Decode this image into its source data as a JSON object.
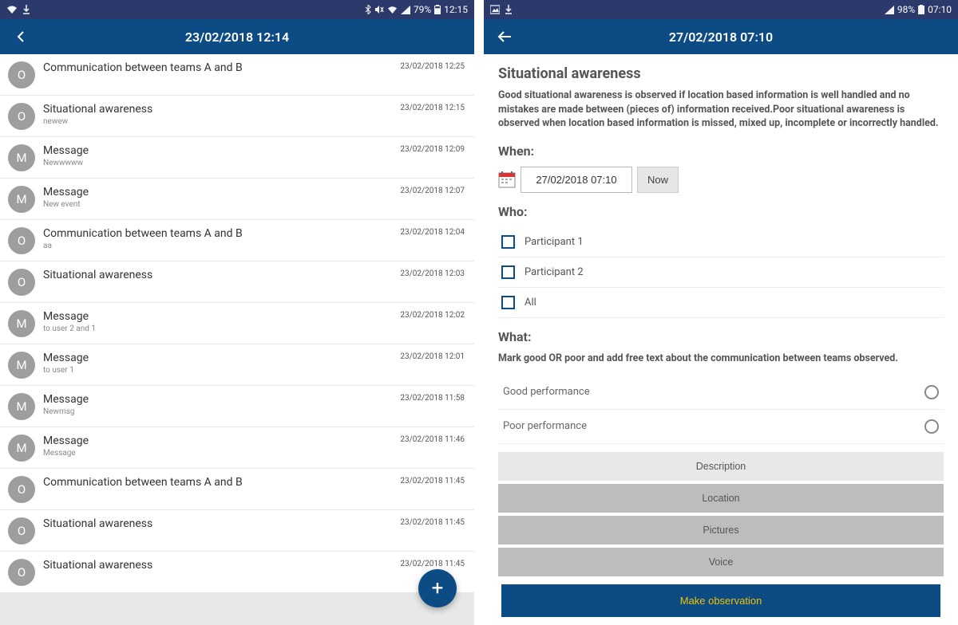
{
  "left": {
    "status": {
      "battery": "79%",
      "time": "12:15"
    },
    "appbar_title": "23/02/2018 12:14",
    "rows": [
      {
        "avatar": "O",
        "title": "Communication between teams A and B",
        "sub": "",
        "time": "23/02/2018 12:25"
      },
      {
        "avatar": "O",
        "title": "Situational awareness",
        "sub": "newew",
        "time": "23/02/2018 12:15"
      },
      {
        "avatar": "M",
        "title": "Message",
        "sub": "Newwwww",
        "time": "23/02/2018 12:09"
      },
      {
        "avatar": "M",
        "title": "Message",
        "sub": "New event",
        "time": "23/02/2018 12:07"
      },
      {
        "avatar": "O",
        "title": "Communication between teams A and B",
        "sub": "aa",
        "time": "23/02/2018 12:04"
      },
      {
        "avatar": "O",
        "title": "Situational awareness",
        "sub": "",
        "time": "23/02/2018 12:03"
      },
      {
        "avatar": "M",
        "title": "Message",
        "sub": "to user 2 and 1",
        "time": "23/02/2018 12:02"
      },
      {
        "avatar": "M",
        "title": "Message",
        "sub": "to user 1",
        "time": "23/02/2018 12:01"
      },
      {
        "avatar": "M",
        "title": "Message",
        "sub": "Newmsg",
        "time": "23/02/2018 11:58"
      },
      {
        "avatar": "M",
        "title": "Message",
        "sub": "Message",
        "time": "23/02/2018 11:46"
      },
      {
        "avatar": "O",
        "title": "Communication between teams A and B",
        "sub": "",
        "time": "23/02/2018 11:45"
      },
      {
        "avatar": "O",
        "title": "Situational awareness",
        "sub": "",
        "time": "23/02/2018 11:45"
      },
      {
        "avatar": "O",
        "title": "Situational awareness",
        "sub": "",
        "time": "23/02/2018 11:45"
      }
    ],
    "fab_label": "+"
  },
  "right": {
    "status": {
      "battery": "98%",
      "time": "07:10"
    },
    "appbar_title": "27/02/2018 07:10",
    "heading": "Situational awareness",
    "description": "Good situational awareness is observed if location based information is well handled and no mistakes are made between (pieces of) information received.Poor situational awareness is observed when location based information is missed, mixed up, incomplete or incorrectly handled.",
    "when_label": "When:",
    "date_value": "27/02/2018 07:10",
    "now_label": "Now",
    "who_label": "Who:",
    "who_items": [
      "Participant 1",
      "Participant 2",
      "All"
    ],
    "what_label": "What:",
    "what_desc": "Mark good OR poor and add free text about the communication between teams observed.",
    "radio_good": "Good performance",
    "radio_poor": "Poor performance",
    "btn_description": "Description",
    "btn_location": "Location",
    "btn_pictures": "Pictures",
    "btn_voice": "Voice",
    "btn_submit": "Make observation"
  }
}
